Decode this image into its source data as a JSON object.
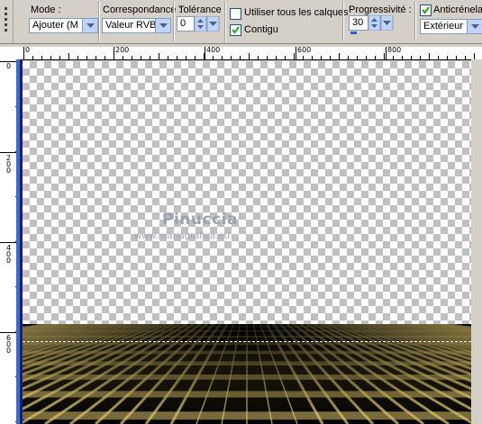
{
  "toolbar": {
    "mode_label": "Mode :",
    "mode_value": "Ajouter (M",
    "correspondance_label": "Correspondance :",
    "correspondance_value": "Valeur RVB",
    "tolerance_label": "Tolérance :",
    "tolerance_value": "0",
    "all_layers_label": "Utiliser tous les calques",
    "all_layers_checked": false,
    "contigu_label": "Contigu",
    "contigu_checked": true,
    "progressivite_label": "Progressivité :",
    "progressivite_value": "30",
    "anticrenelage_label": "Anticrénelage",
    "anticrenelage_checked": true,
    "anticrenelage_mode": "Extérieur"
  },
  "ruler_top": {
    "labels": [
      "0",
      "200",
      "400",
      "600",
      "800"
    ]
  },
  "ruler_left": {
    "labels": [
      "0",
      "200",
      "400",
      "600"
    ]
  },
  "watermark": {
    "name": "Pinuccia",
    "url": "www.mariagrafica.eu"
  },
  "colors": {
    "accent_blue": "#3a6bd1",
    "floor_gold": "#d7c06a",
    "floor_dark": "#000000"
  }
}
